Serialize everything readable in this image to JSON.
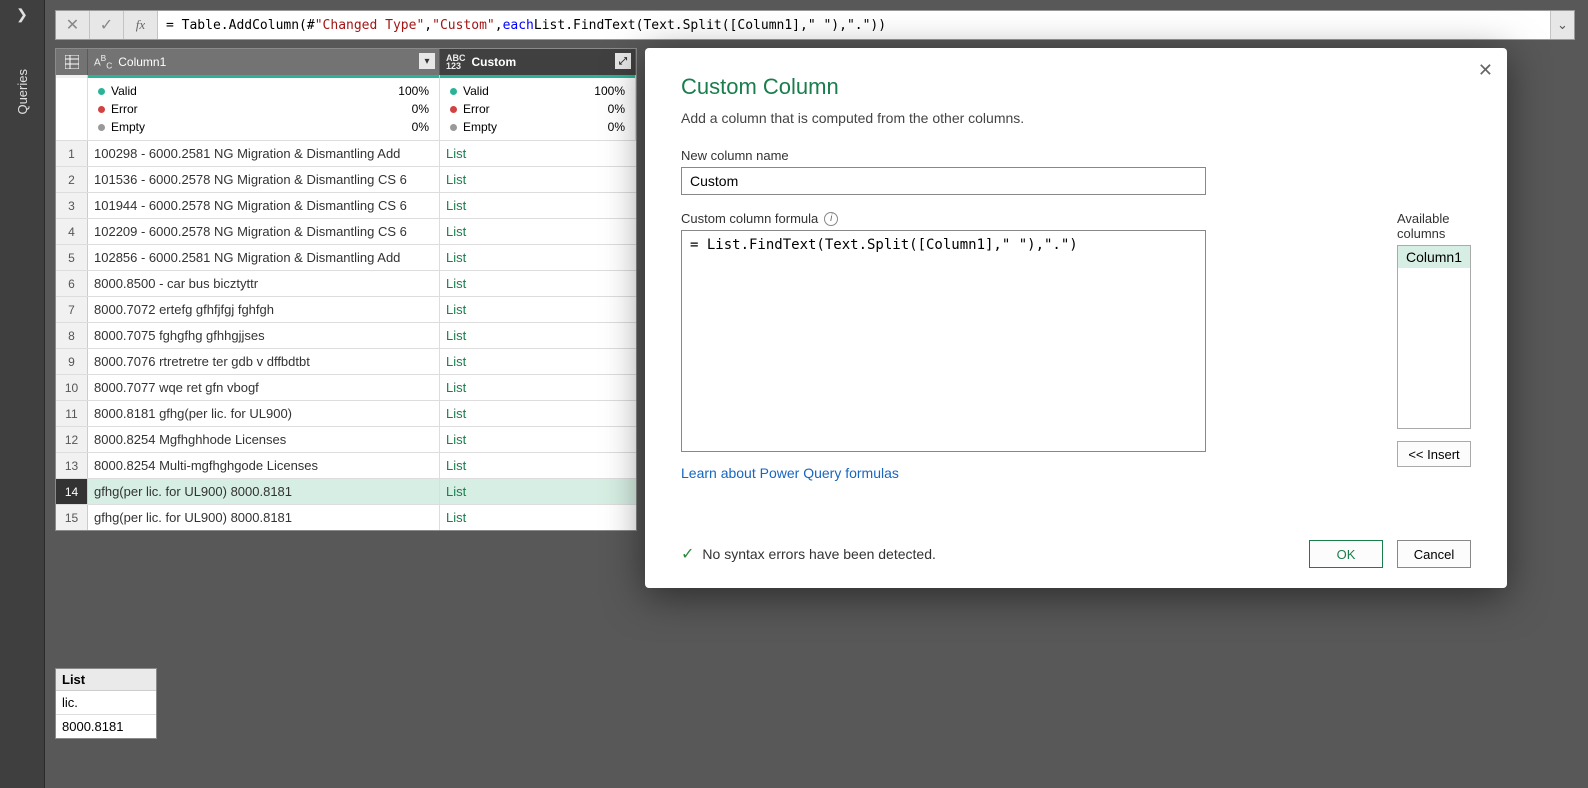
{
  "sidebar": {
    "label": "Queries"
  },
  "formula_bar": {
    "prefix": "= Table.AddColumn(#",
    "str1": "\"Changed Type\"",
    "sep1": ", ",
    "str2": "\"Custom\"",
    "sep2": ", ",
    "kw": "each",
    "rest": " List.FindText(Text.Split([Column1],\" \"),\".\"))"
  },
  "columns": {
    "col1": {
      "name": "Column1",
      "type_icon": "Aᴮc"
    },
    "col2": {
      "name": "Custom",
      "type_icon": "ABC 123"
    }
  },
  "stats": {
    "valid_label": "Valid",
    "error_label": "Error",
    "empty_label": "Empty",
    "col1": {
      "valid": "100%",
      "error": "0%",
      "empty": "0%"
    },
    "col2": {
      "valid": "100%",
      "error": "0%",
      "empty": "0%"
    }
  },
  "rows": [
    {
      "n": "1",
      "c1": "100298 - 6000.2581 NG Migration & Dismantling Add",
      "c2": "List"
    },
    {
      "n": "2",
      "c1": "101536 - 6000.2578 NG Migration & Dismantling CS 6",
      "c2": "List"
    },
    {
      "n": "3",
      "c1": "101944 - 6000.2578 NG Migration & Dismantling CS 6",
      "c2": "List"
    },
    {
      "n": "4",
      "c1": "102209 - 6000.2578 NG Migration & Dismantling CS 6",
      "c2": "List"
    },
    {
      "n": "5",
      "c1": "102856 - 6000.2581 NG Migration & Dismantling Add",
      "c2": "List"
    },
    {
      "n": "6",
      "c1": "8000.8500 - car bus bicztyttr",
      "c2": "List"
    },
    {
      "n": "7",
      "c1": "8000.7072 ertefg gfhfjfgj fghfgh",
      "c2": "List"
    },
    {
      "n": "8",
      "c1": "8000.7075 fghgfhg gfhhgjjses",
      "c2": "List"
    },
    {
      "n": "9",
      "c1": "8000.7076 rtretretre ter gdb v dffbdtbt",
      "c2": "List"
    },
    {
      "n": "10",
      "c1": "8000.7077 wqe ret gfn vbogf",
      "c2": "List"
    },
    {
      "n": "11",
      "c1": "8000.8181 gfhg(per lic. for UL900)",
      "c2": "List"
    },
    {
      "n": "12",
      "c1": "8000.8254 Mgfhghhode Licenses",
      "c2": "List"
    },
    {
      "n": "13",
      "c1": "8000.8254 Multi-mgfhghgode Licenses",
      "c2": "List"
    },
    {
      "n": "14",
      "c1": "gfhg(per lic. for UL900) 8000.8181",
      "c2": "List"
    },
    {
      "n": "15",
      "c1": "gfhg(per lic. for UL900) 8000.8181",
      "c2": "List"
    }
  ],
  "selected_row": 14,
  "preview": {
    "header": "List",
    "items": [
      "lic.",
      "8000.8181"
    ]
  },
  "dialog": {
    "title": "Custom Column",
    "subtitle": "Add a column that is computed from the other columns.",
    "name_label": "New column name",
    "name_value": "Custom",
    "formula_label": "Custom column formula",
    "formula_value": "= List.FindText(Text.Split([Column1],\" \"),\".\")",
    "avail_label": "Available columns",
    "avail_items": [
      "Column1"
    ],
    "insert_label": "<< Insert",
    "learn_link": "Learn about Power Query formulas",
    "status_text": "No syntax errors have been detected.",
    "ok": "OK",
    "cancel": "Cancel"
  }
}
